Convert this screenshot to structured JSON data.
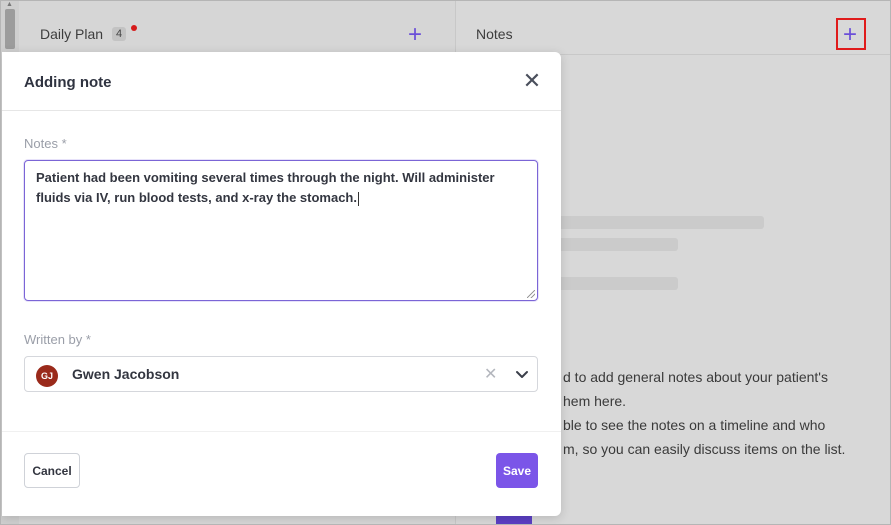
{
  "daily_plan": {
    "title": "Daily Plan",
    "count": "4",
    "add_label": "+"
  },
  "notes_panel": {
    "title": "Notes",
    "add_label": "+",
    "empty_text": [
      "d to add general notes about your patient's",
      "hem here.",
      "ble to see the notes on a timeline and who",
      "m, so you can easily discuss items on the list."
    ]
  },
  "modal": {
    "title": "Adding note",
    "close_label": "✕",
    "notes_label": "Notes *",
    "notes_value": "Patient had been vomiting several times through the night. Will administer fluids via IV, run blood tests, and x-ray the stomach.",
    "written_by_label": "Written by *",
    "author": {
      "initials": "GJ",
      "name": "Gwen Jacobson"
    },
    "clear_label": "✕",
    "cancel_label": "Cancel",
    "save_label": "Save"
  },
  "colors": {
    "accent": "#7b55e8",
    "avatar": "#9a2a1b",
    "highlight": "#e01b1b"
  }
}
